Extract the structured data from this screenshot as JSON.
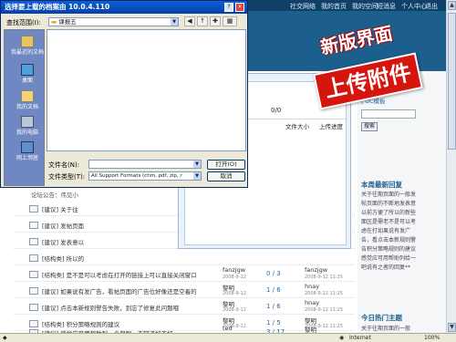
{
  "dialog": {
    "title": "选择要上载的档案由 10.0.4.110",
    "look_in_label": "查找范围(I):",
    "look_in_value": "课报五",
    "places": [
      {
        "label": "我最近的文档",
        "icon": "recent-docs-icon"
      },
      {
        "label": "桌面",
        "icon": "desktop-icon"
      },
      {
        "label": "我的文档",
        "icon": "my-documents-icon"
      },
      {
        "label": "我的电脑",
        "icon": "my-computer-icon"
      },
      {
        "label": "网上邻居",
        "icon": "network-icon"
      }
    ],
    "filename_label": "文件名(N):",
    "filename_value": "",
    "filetype_label": "文件类型(T):",
    "filetype_value": "All Support Formats (chm, pdf, zip, r",
    "open_label": "打开(O)",
    "cancel_label": "取消"
  },
  "header": {
    "nav": [
      "社交网络",
      "我的首页",
      "我的空间",
      "短消息",
      "个人中心",
      "退出"
    ]
  },
  "badge": {
    "line1": "新版界面",
    "line2": "上传附件"
  },
  "uploader": {
    "count": "0/0",
    "col_size": "文件大小",
    "col_progress": "上传进度"
  },
  "sidebar": {
    "uc_link": "| UC模板",
    "search_button": "搜索",
    "recent_title": "本周最新回复",
    "recent_text": "关于往期页面的一般发帖页面的不断地发表意以前方便了所以的新些面区是需老不是可以考虑在打如果说有发广告，看点击本新规则警告积分策略规则的建议感觉应可用帮助列给一吧说有之者的回复**",
    "hot_title": "今日热门主题",
    "hot_text": "关于往期页面的一般"
  },
  "forum": {
    "announce": "论坛公告：伟见小",
    "rows": [
      {
        "title": "[建议] 关于往",
        "author": "",
        "date": "",
        "replies": "",
        "last": "",
        "lastdate": ""
      },
      {
        "title": "[建议] 发帖页面",
        "author": "",
        "date": "",
        "replies": "",
        "last": "",
        "lastdate": ""
      },
      {
        "title": "[建议] 发表意以",
        "author": "",
        "date": "",
        "replies": "",
        "last": "",
        "lastdate": ""
      },
      {
        "title": "[结构类] 所以的",
        "author": "",
        "date": "",
        "replies": "",
        "last": "",
        "lastdate": ""
      },
      {
        "title": "[结构类] 是不是可以考虑在打开的链接上可以直接关闭窗口",
        "author": "fanzjgw",
        "date": "2008-9-12",
        "replies": "0 / 3",
        "last": "fanzjgw",
        "lastdate": "2008-9-12 11:25"
      },
      {
        "title": "[建议] 如果说有发广告，看帖页面的广告位好像还是空着的",
        "author": "黎明",
        "date": "2008-9-12",
        "replies": "1 / 6",
        "last": "hnay",
        "lastdate": "2008-9-12 11:25"
      },
      {
        "title": "[建议] 点击本新规则警告失败，到忘了修复此问题哦",
        "author": "黎明",
        "date": "2008-9-12",
        "replies": "1 / 6",
        "last": "hnay",
        "lastdate": "2008-9-12 11:25"
      },
      {
        "title": "[结构类] 积分策略规则的建议",
        "author": "黎明",
        "date": "2008-9-12",
        "replies": "1 / 5",
        "last": "黎明",
        "lastdate": "2008-9-12 11:25"
      },
      {
        "title": "[建议] 感觉应可用帮助列一个帮程，不知道好不好～",
        "author": "ted",
        "date": "2008-9-12",
        "replies": "3 / 17",
        "last": "黎明",
        "lastdate": "2008-9-12 11:25"
      }
    ]
  },
  "statusbar": {
    "zone": "Internet",
    "zoom": "100%"
  }
}
